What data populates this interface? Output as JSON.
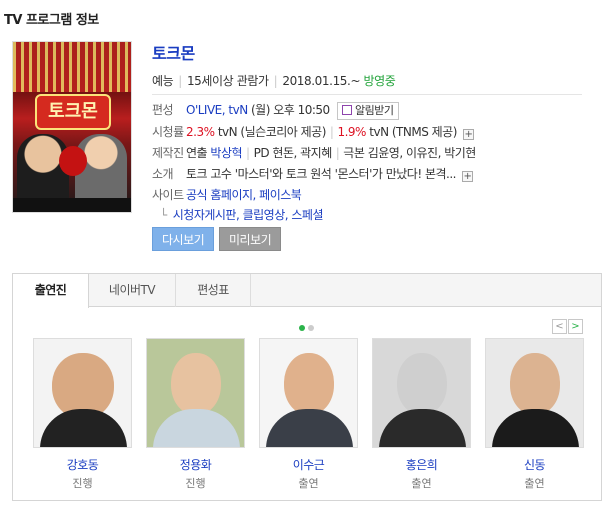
{
  "header": {
    "title": "TV 프로그램 정보"
  },
  "program": {
    "title": "토크몬",
    "genre": "예능",
    "rating": "15세이상 관람가",
    "start_date": "2018.01.15.~",
    "status": "방영중"
  },
  "schedule": {
    "label": "편성",
    "channel": "O'LIVE, tvN",
    "time": "(월) 오후 10:50",
    "alarm_label": "알림받기"
  },
  "ratings": {
    "label": "시청률",
    "r1_value": "2.3%",
    "r1_channel": "tvN (닐슨코리아 제공)",
    "r2_value": "1.9%",
    "r2_channel": "tvN (TNMS 제공)"
  },
  "crew": {
    "label": "제작진",
    "director_label": "연출",
    "director": "박상혁",
    "pd_label": "PD",
    "pd_names": "현돈, 곽지혜",
    "writer_label": "극본",
    "writers": "김윤영, 이유진, 박기현"
  },
  "intro": {
    "label": "소개",
    "text": "토크 고수 '마스터'와 토크 원석 '몬스터'가 만났다! 본격..."
  },
  "site": {
    "label": "사이트",
    "links": "공식 홈페이지, 페이스북",
    "sub_links": "시청자게시판, 클립영상, 스페셜"
  },
  "buttons": {
    "replay": "다시보기",
    "preview": "미리보기"
  },
  "tabs": [
    "출연진",
    "네이버TV",
    "편성표"
  ],
  "cast": [
    {
      "name": "강호동",
      "role": "진행"
    },
    {
      "name": "정용화",
      "role": "진행"
    },
    {
      "name": "이수근",
      "role": "출연"
    },
    {
      "name": "홍은희",
      "role": "출연"
    },
    {
      "name": "신동",
      "role": "출연"
    }
  ],
  "icons": {
    "plus": "plus-icon",
    "calendar": "calendar-icon",
    "prev": "chevron-left-icon",
    "next": "chevron-right-icon"
  },
  "colors": {
    "link_blue": "#1a3dc1",
    "rating_red": "#dd1122",
    "on_air_green": "#22a33a",
    "replay_btn": "#7fb1ea",
    "preview_btn": "#9b9b9b"
  },
  "poster": {
    "logo_text": "토크몬"
  }
}
